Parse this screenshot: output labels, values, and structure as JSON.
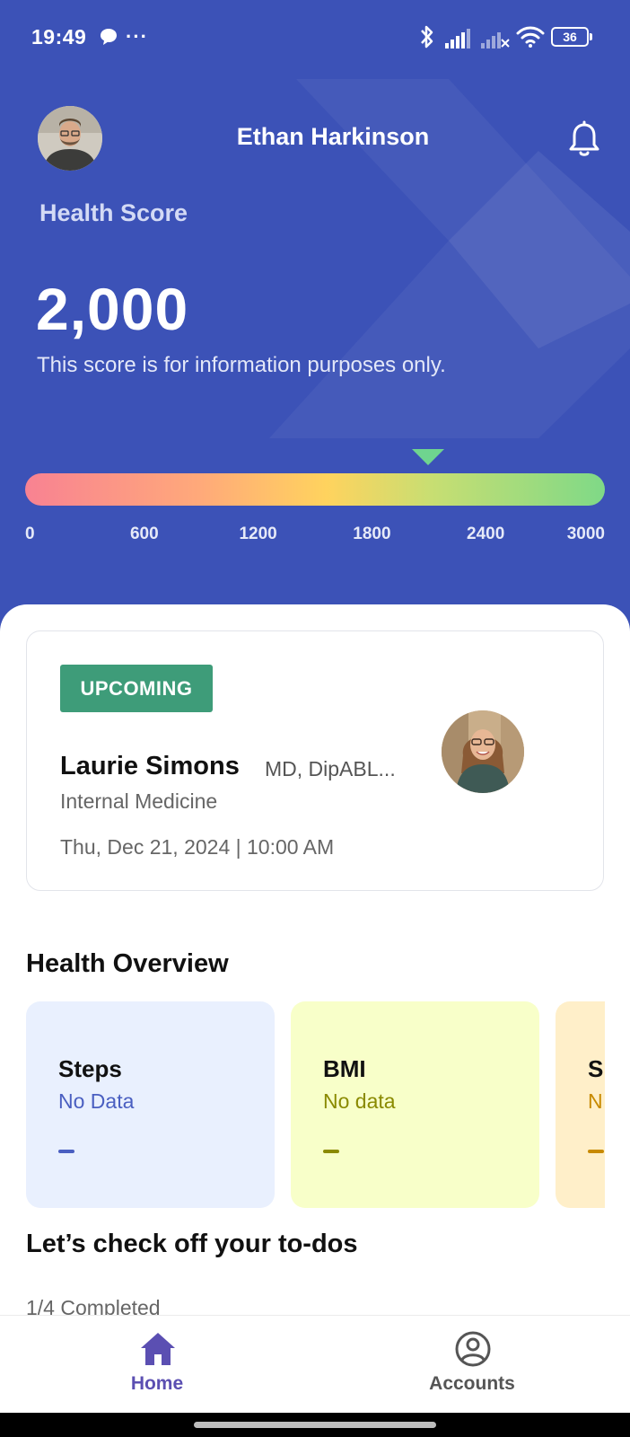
{
  "status_bar": {
    "time": "19:49",
    "more": "···",
    "battery": "36",
    "icons": [
      "message-icon",
      "bluetooth-icon",
      "signal-icon",
      "signal-no-service-icon",
      "wifi-icon",
      "battery-icon"
    ]
  },
  "header": {
    "user_name": "Ethan Harkinson",
    "avatar_icon": "user-avatar",
    "notification_icon": "bell-icon"
  },
  "health_score": {
    "label": "Health Score",
    "value": "2,000",
    "note": "This score is for information purposes only.",
    "gauge": {
      "min": 0,
      "max": 3000,
      "marker_value": 2087,
      "ticks": [
        "0",
        "600",
        "1200",
        "1800",
        "2400",
        "3000"
      ],
      "colors": [
        "#F88292",
        "#FFD35E",
        "#7FD987"
      ]
    }
  },
  "appointment": {
    "badge": "UPCOMING",
    "doctor_name": "Laurie Simons",
    "credentials": "MD, DipABL...",
    "specialty": "Internal Medicine",
    "datetime": "Thu, Dec 21, 2024 | 10:00 AM",
    "badge_color": "#3E9C79"
  },
  "health_overview": {
    "title": "Health Overview",
    "cards": [
      {
        "label": "Steps",
        "value": "No Data",
        "dash": "–",
        "bg": "#E9F0FE",
        "accent": "#4A5FC1"
      },
      {
        "label": "BMI",
        "value": "No data",
        "dash": "–",
        "bg": "#F8FFC9",
        "accent": "#8A8A00"
      },
      {
        "label": "S",
        "value": "N",
        "dash": "–",
        "bg": "#FFEFC9",
        "accent": "#C88A00"
      }
    ]
  },
  "todos": {
    "title": "Let’s check off your to-dos",
    "progress": "1/4 Completed"
  },
  "bottom_nav": {
    "items": [
      {
        "label": "Home",
        "icon": "home-icon",
        "active": true
      },
      {
        "label": "Accounts",
        "icon": "account-icon",
        "active": false
      }
    ],
    "active_color": "#5B4FB2",
    "inactive_color": "#555555"
  }
}
